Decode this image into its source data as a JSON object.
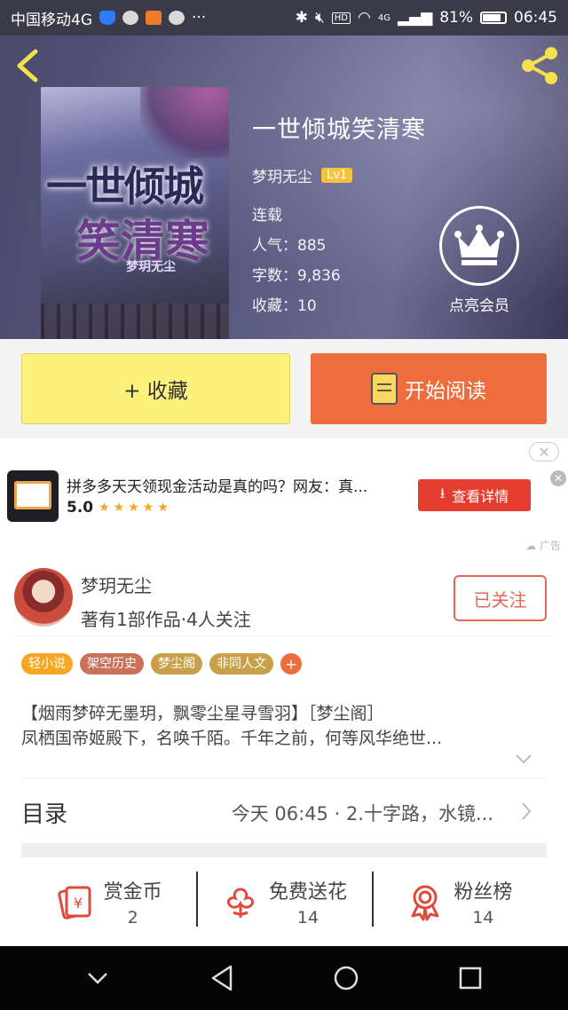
{
  "status_bar": {
    "carrier": "中国移动4G",
    "battery": "81%",
    "time": "06:45",
    "network": "4G"
  },
  "book": {
    "title": "一世倾城笑清寒",
    "author": "梦玥无尘",
    "level": "Lv1",
    "status": "连载",
    "popularity": "人气：885",
    "word_count": "字数：9,836",
    "favorites": "收藏：10",
    "cover": {
      "title_line1": "一世倾城",
      "title_line2": "笑清寒",
      "author": "梦玥无尘"
    }
  },
  "vip": {
    "label": "点亮会员"
  },
  "actions": {
    "favorite_label": "+ 收藏",
    "read_label": "开始阅读"
  },
  "ad": {
    "title": "拼多多天天领现金活动是真的吗？网友：真...",
    "score": "5.0",
    "button_label": "查看详情",
    "tag": "广告"
  },
  "author_section": {
    "name": "梦玥无尘",
    "summary": "著有1部作品·4人关注",
    "follow_label": "已关注"
  },
  "tags": [
    {
      "label": "轻小说",
      "color": "#f5a623"
    },
    {
      "label": "架空历史",
      "color": "#c9715a"
    },
    {
      "label": "梦尘阁",
      "color": "#c9a04a"
    },
    {
      "label": "非同人文",
      "color": "#c9a04a"
    }
  ],
  "tag_add": "+",
  "description": {
    "line1": "【烟雨梦碎无墨玥，飘零尘星寻雪羽】［梦尘阁］",
    "line2": "凤栖国帝姬殿下，名唤千陌。千年之前，何等风华绝世..."
  },
  "catalog": {
    "label": "目录",
    "latest": "今天 06:45 · 2.十字路，水镜..."
  },
  "stats": [
    {
      "label": "赏金币",
      "value": "2",
      "icon": "coin-envelope-icon"
    },
    {
      "label": "免费送花",
      "value": "14",
      "icon": "flower-icon"
    },
    {
      "label": "粉丝榜",
      "value": "14",
      "icon": "award-ribbon-icon"
    }
  ],
  "colors": {
    "accent": "#ee6d3c",
    "favorite_bg": "#fbf17b",
    "ad_button": "#e53d2f",
    "follow": "#e4685a",
    "icon_red": "#e04a3a"
  }
}
